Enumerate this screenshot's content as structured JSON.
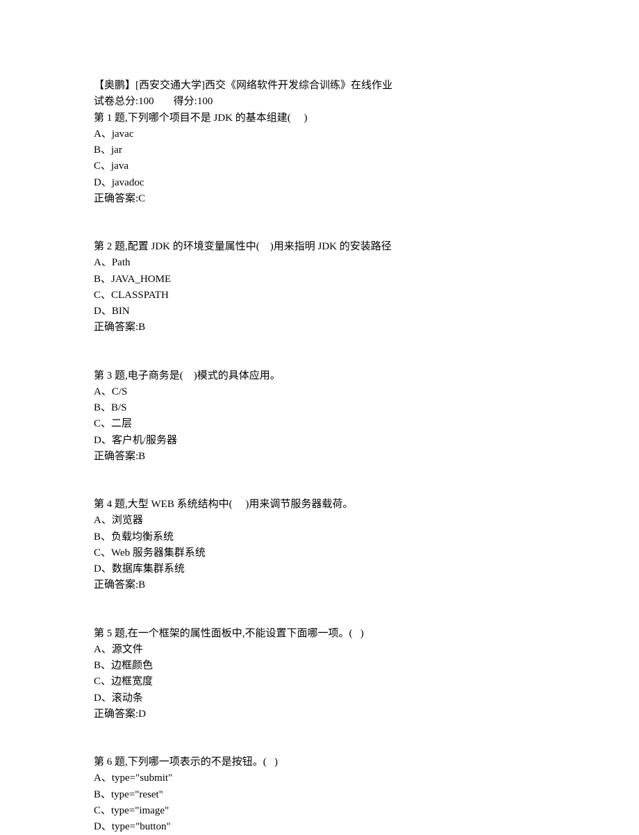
{
  "header": {
    "title": "【奥鹏】[西安交通大学]西交《网络软件开发综合训练》在线作业"
  },
  "score": {
    "total_label": "试卷总分:100",
    "got_label": "得分:100"
  },
  "questions": [
    {
      "stem": "第 1 题,下列哪个项目不是 JDK 的基本组建(     )",
      "options": [
        "A、javac",
        "B、jar",
        "C、java",
        "D、javadoc"
      ],
      "answer": "正确答案:C"
    },
    {
      "stem": "第 2 题,配置 JDK 的环境变量属性中(    )用来指明 JDK 的安装路径",
      "options": [
        "A、Path",
        "B、JAVA_HOME",
        "C、CLASSPATH",
        "D、BIN"
      ],
      "answer": "正确答案:B"
    },
    {
      "stem": "第 3 题,电子商务是(    )模式的具体应用。",
      "options": [
        "A、C/S",
        "B、B/S",
        "C、二层",
        "D、客户机/服务器"
      ],
      "answer": "正确答案:B"
    },
    {
      "stem": "第 4 题,大型 WEB 系统结构中(     )用来调节服务器载荷。",
      "options": [
        "A、浏览器",
        "B、负载均衡系统",
        "C、Web 服务器集群系统",
        "D、数据库集群系统"
      ],
      "answer": "正确答案:B"
    },
    {
      "stem": "第 5 题,在一个框架的属性面板中,不能设置下面哪一项。(   )",
      "options": [
        "A、源文件",
        "B、边框颜色",
        "C、边框宽度",
        "D、滚动条"
      ],
      "answer": "正确答案:D"
    },
    {
      "stem": "第 6 题,下列哪一项表示的不是按钮。(   )",
      "options": [
        "A、type=\"submit\"",
        "B、type=\"reset\"",
        "C、type=\"image\"",
        "D、type=\"button\""
      ],
      "answer": ""
    }
  ]
}
